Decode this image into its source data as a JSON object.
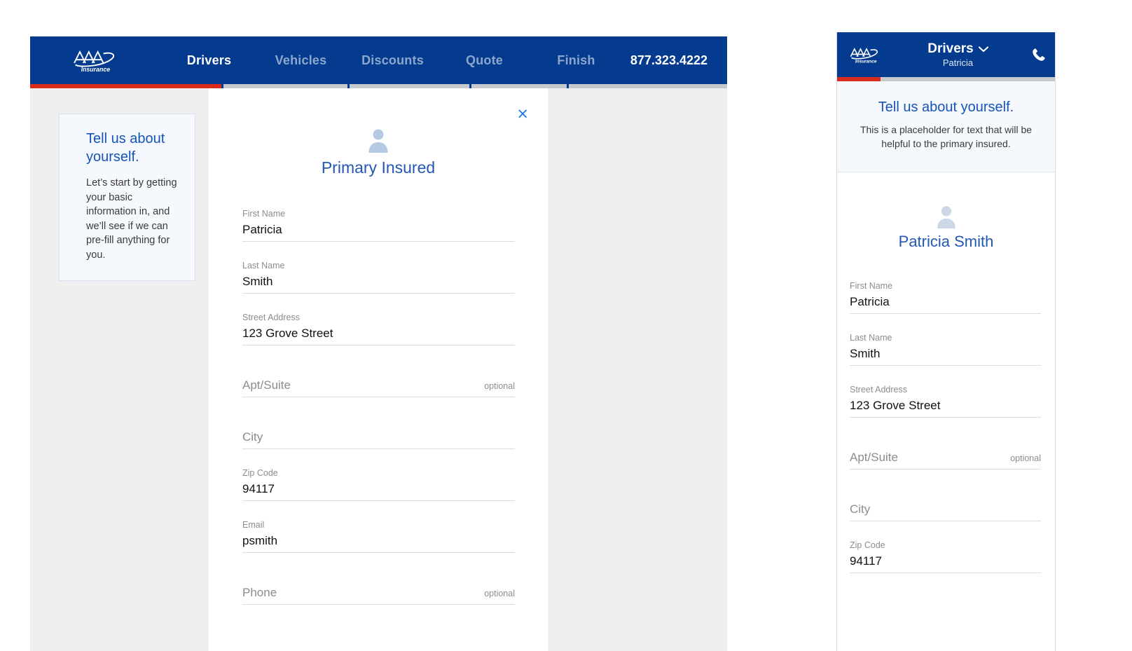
{
  "desktop": {
    "nav": {
      "logo_alt": "AAA Insurance",
      "tabs": [
        {
          "label": "Drivers",
          "active": true
        },
        {
          "label": "Vehicles",
          "active": false
        },
        {
          "label": "Discounts",
          "active": false
        },
        {
          "label": "Quote",
          "active": false
        },
        {
          "label": "Finish",
          "active": false
        }
      ],
      "phone": "877.323.4222",
      "progress_segments": [
        "done",
        "todo",
        "todo",
        "todo",
        "todo"
      ]
    },
    "info_card": {
      "title": "Tell us about yourself.",
      "body": "Let’s start by getting your basic information in, and we’ll see if we can pre-fill anything for you."
    },
    "form_card": {
      "close_label": "×",
      "avatar_icon": "person-icon",
      "title": "Primary Insured",
      "fields": [
        {
          "label": "First Name",
          "value": "Patricia",
          "placeholder": "",
          "optional": ""
        },
        {
          "label": "Last Name",
          "value": "Smith",
          "placeholder": "",
          "optional": ""
        },
        {
          "label": "Street Address",
          "value": "123 Grove Street",
          "placeholder": "",
          "optional": ""
        },
        {
          "label": "",
          "value": "",
          "placeholder": "Apt/Suite",
          "optional": "optional"
        },
        {
          "label": "",
          "value": "",
          "placeholder": "City",
          "optional": ""
        },
        {
          "label": "Zip Code",
          "value": "94117",
          "placeholder": "",
          "optional": ""
        },
        {
          "label": "Email",
          "value": "psmith",
          "placeholder": "",
          "optional": ""
        },
        {
          "label": "",
          "value": "",
          "placeholder": "Phone",
          "optional": "optional"
        }
      ]
    }
  },
  "mobile": {
    "nav": {
      "logo_alt": "AAA Insurance",
      "title": "Drivers",
      "subtitle": "Patricia",
      "chevron_icon": "chevron-down-icon",
      "phone_icon": "phone-handset-icon",
      "progress_percent": 20
    },
    "intro": {
      "title": "Tell us about yourself.",
      "body": "This is a placeholder for text that will be helpful to the primary insured."
    },
    "card": {
      "avatar_icon": "person-icon",
      "title": "Patricia Smith",
      "fields": [
        {
          "label": "First Name",
          "value": "Patricia",
          "placeholder": "",
          "optional": ""
        },
        {
          "label": "Last Name",
          "value": "Smith",
          "placeholder": "",
          "optional": ""
        },
        {
          "label": "Street Address",
          "value": "123 Grove Street",
          "placeholder": "",
          "optional": ""
        },
        {
          "label": "",
          "value": "",
          "placeholder": "Apt/Suite",
          "optional": "optional"
        },
        {
          "label": "",
          "value": "",
          "placeholder": "City",
          "optional": ""
        },
        {
          "label": "Zip Code",
          "value": "94117",
          "placeholder": "",
          "optional": ""
        }
      ]
    }
  },
  "colors": {
    "nav_blue": "#043b8f",
    "accent_red": "#d92b1c",
    "link_blue": "#1678e8",
    "title_blue": "#1554b8",
    "page_bg": "#efefef"
  }
}
